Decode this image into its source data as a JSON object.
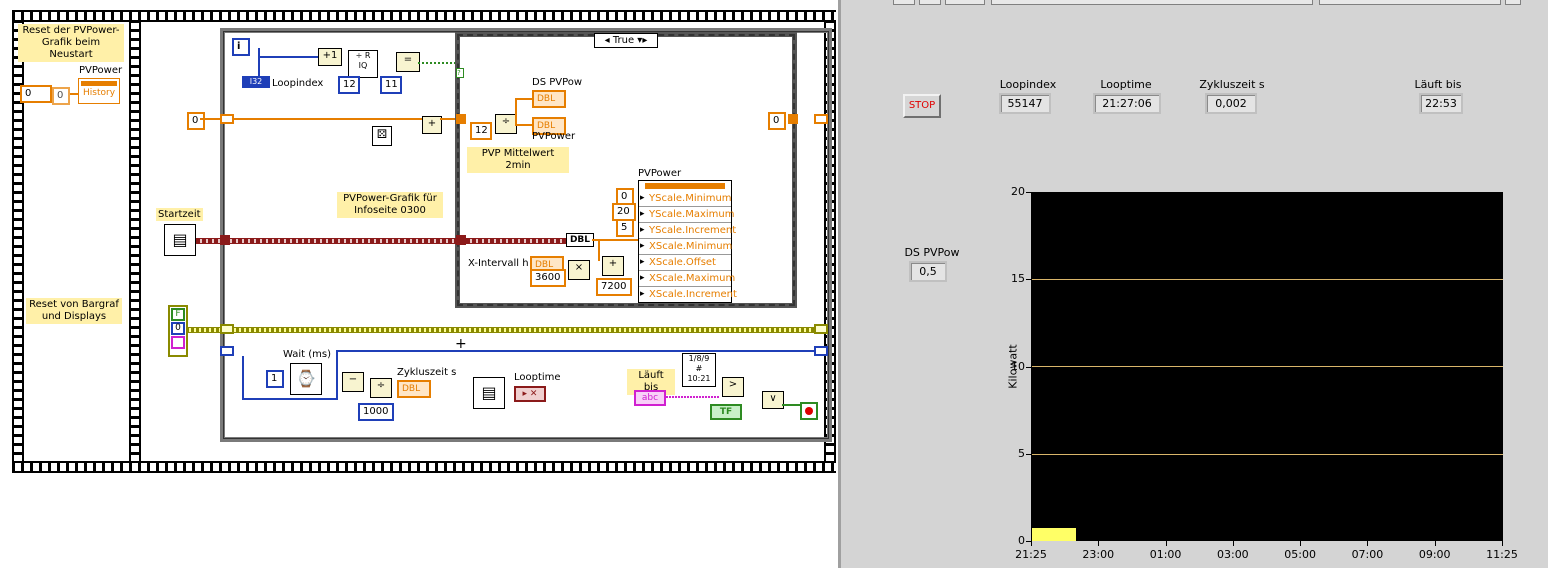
{
  "diagram": {
    "reset_label": "Reset der PVPower-Grafik beim Neustart",
    "reset_const": "0",
    "reset_const2": "0",
    "pvpower_label": "PVPower",
    "history_label": "History",
    "reset_bargraf_label": "Reset von Bargraf und Displays",
    "startzeit_label": "Startzeit",
    "loop_i": "i",
    "loopindex_label": "Loopindex",
    "i32_label": "I32",
    "plus1": "+1",
    "const_12a": "12",
    "const_11": "11",
    "case_selector": "True",
    "ds_pvpow_label": "DS PVPow",
    "dbl_label": "DBL",
    "pvpower_label2": "PVPower",
    "const_12b": "12",
    "pvp_mittelwert": "PVP Mittelwert 2min",
    "shift_const_left": "0",
    "shift_const_right": "0",
    "grafik_label": "PVPower-Grafik für Infoseite 0300",
    "pvpower_node_title": "PVPower",
    "props": [
      "YScale.Minimum",
      "YScale.Maximum",
      "YScale.Increment",
      "XScale.Minimum",
      "XScale.Offset",
      "XScale.Maximum",
      "XScale.Increment"
    ],
    "prop_consts": [
      "0",
      "20",
      "5"
    ],
    "x_intervall_label": "X-Intervall h",
    "const_3600": "3600",
    "const_7200": "7200",
    "bool_f": "F",
    "bool_0": "0",
    "wait_label": "Wait (ms)",
    "const_1": "1",
    "const_1000": "1000",
    "zykluszeit_label": "Zykluszeit s",
    "looptime_label": "Looptime",
    "laeuft_bis_label": "Läuft bis",
    "abc_label": "abc",
    "tf_label": "TF"
  },
  "panel": {
    "stop_label": "STOP",
    "loopindex_label": "Loopindex",
    "loopindex_value": "55147",
    "looptime_label": "Looptime",
    "looptime_value": "21:27:06",
    "zykluszeit_label": "Zykluszeit s",
    "zykluszeit_value": "0,002",
    "laeuft_bis_label": "Läuft bis",
    "laeuft_bis_value": "22:53",
    "ds_pvpow_label": "DS PVPow",
    "ds_pvpow_value": "0,5",
    "y_axis_label": "Kilowatt"
  },
  "chart_data": {
    "type": "area",
    "ylabel": "Kilowatt",
    "ylim": [
      0,
      20
    ],
    "yticks": [
      "0",
      "5",
      "10",
      "15",
      "20"
    ],
    "xticks": [
      "21:25",
      "23:00",
      "01:00",
      "03:00",
      "05:00",
      "07:00",
      "09:00",
      "11:25"
    ],
    "gridlines_y": [
      5,
      10,
      15
    ],
    "series": [
      {
        "x_start": "21:25",
        "x_end": "22:53",
        "values_approx": [
          0.7,
          0.8,
          0.7,
          0.8,
          0.7,
          0.8,
          0.7,
          0.8,
          0.7,
          0.8
        ]
      }
    ],
    "colors": {
      "plot_bg": "#000000",
      "fill": "#ffff66",
      "grid": "#d9b56a"
    }
  }
}
